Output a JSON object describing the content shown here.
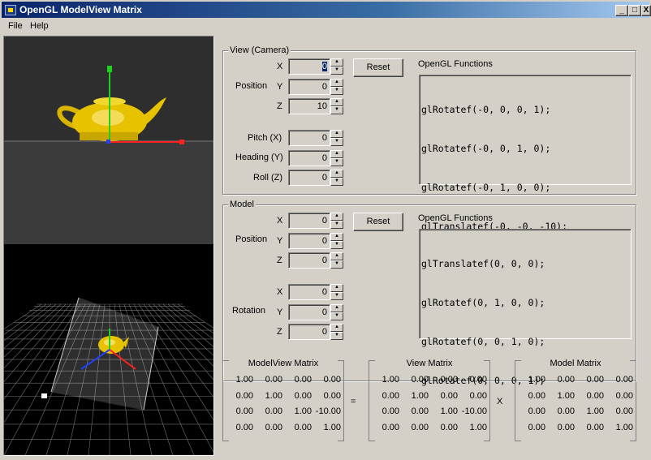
{
  "window": {
    "title": "OpenGL ModelView Matrix",
    "minimize": "_",
    "maximize": "□",
    "close": "X"
  },
  "menu": [
    "File",
    "Help"
  ],
  "view_group": {
    "label": "View (Camera)",
    "position_label": "Position",
    "x_label": "X",
    "y_label": "Y",
    "z_label": "Z",
    "x": "0",
    "y": "0",
    "z": "10",
    "pitch_label": "Pitch (X)",
    "heading_label": "Heading (Y)",
    "roll_label": "Roll (Z)",
    "pitch": "0",
    "heading": "0",
    "roll": "0",
    "reset": "Reset",
    "functions_label": "OpenGL Functions",
    "code": [
      "glRotatef(-0, 0, 0, 1);",
      "glRotatef(-0, 0, 1, 0);",
      "glRotatef(-0, 1, 0, 0);",
      "glTranslatef(-0, -0, -10);"
    ]
  },
  "model_group": {
    "label": "Model",
    "position_label": "Position",
    "rotation_label": "Rotation",
    "x_label": "X",
    "y_label": "Y",
    "z_label": "Z",
    "x": "0",
    "y": "0",
    "z": "0",
    "rx": "0",
    "ry": "0",
    "rz": "0",
    "reset": "Reset",
    "functions_label": "OpenGL Functions",
    "code": [
      "glTranslatef(0, 0, 0);",
      "glRotatef(0, 1, 0, 0);",
      "glRotatef(0, 0, 1, 0);",
      "glRotatef(0, 0, 0, 1);"
    ]
  },
  "matrices": {
    "modelview": {
      "title": "ModelView Matrix",
      "rows": [
        [
          "1.00",
          "0.00",
          "0.00",
          "0.00"
        ],
        [
          "0.00",
          "1.00",
          "0.00",
          "0.00"
        ],
        [
          "0.00",
          "0.00",
          "1.00",
          "-10.00"
        ],
        [
          "0.00",
          "0.00",
          "0.00",
          "1.00"
        ]
      ]
    },
    "view": {
      "title": "View Matrix",
      "rows": [
        [
          "1.00",
          "0.00",
          "0.00",
          "0.00"
        ],
        [
          "0.00",
          "1.00",
          "0.00",
          "0.00"
        ],
        [
          "0.00",
          "0.00",
          "1.00",
          "-10.00"
        ],
        [
          "0.00",
          "0.00",
          "0.00",
          "1.00"
        ]
      ]
    },
    "model": {
      "title": "Model Matrix",
      "rows": [
        [
          "1.00",
          "0.00",
          "0.00",
          "0.00"
        ],
        [
          "0.00",
          "1.00",
          "0.00",
          "0.00"
        ],
        [
          "0.00",
          "0.00",
          "1.00",
          "0.00"
        ],
        [
          "0.00",
          "0.00",
          "0.00",
          "1.00"
        ]
      ]
    },
    "equals": "=",
    "times": "X"
  },
  "colors": {
    "titlebar": "#0a246a",
    "teapot": "#e6c200",
    "axis_x": "#ff2020",
    "axis_y": "#20d020",
    "axis_z": "#2040ff"
  }
}
